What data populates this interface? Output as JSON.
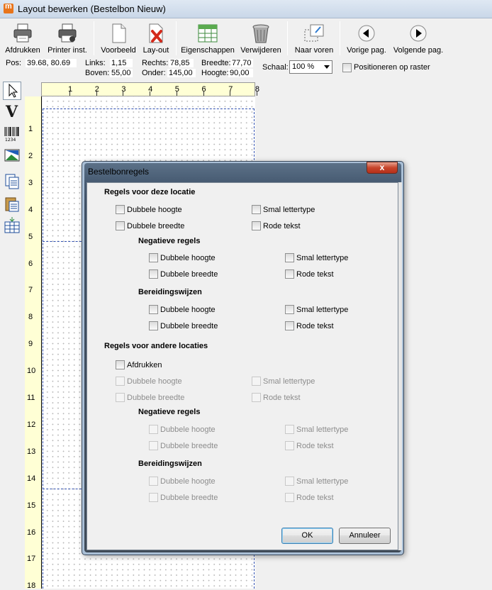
{
  "window": {
    "title": "Layout bewerken (Bestelbon Nieuw)"
  },
  "toolbar": {
    "buttons": [
      {
        "label": "Afdrukken",
        "icon": "printer-icon"
      },
      {
        "label": "Printer inst.",
        "icon": "printer-settings-icon"
      },
      {
        "label": "Voorbeeld",
        "icon": "document-icon"
      },
      {
        "label": "Lay-out",
        "icon": "layout-delete-icon"
      },
      {
        "label": "Eigenschappen",
        "icon": "table-properties-icon"
      },
      {
        "label": "Verwijderen",
        "icon": "trash-icon"
      },
      {
        "label": "Naar voren",
        "icon": "bring-forward-icon"
      },
      {
        "label": "Vorige pag.",
        "icon": "previous-arrow-icon"
      },
      {
        "label": "Volgende pag.",
        "icon": "next-arrow-icon"
      }
    ]
  },
  "info": {
    "pos_label": "Pos:",
    "pos_value": "39.68, 80.69",
    "links_label": "Links:",
    "links_value": "1,15",
    "boven_label": "Boven:",
    "boven_value": "55,00",
    "rechts_label": "Rechts:",
    "rechts_value": "78,85",
    "onder_label": "Onder:",
    "onder_value": "145,00",
    "breedte_label": "Breedte:",
    "breedte_value": "77,70",
    "hoogte_label": "Hoogte:",
    "hoogte_value": "90,00",
    "schaal_label": "Schaal:",
    "schaal_value": "100 %",
    "raster_label": "Positioneren op raster"
  },
  "tools": [
    "pointer-icon",
    "text-tool-icon",
    "barcode-icon",
    "image-tool-icon",
    "copy-icon",
    "paste-icon",
    "insert-field-icon"
  ],
  "ruler": {
    "top": [
      "1",
      "2",
      "3",
      "4",
      "5",
      "6",
      "7",
      "8"
    ],
    "left": [
      "1",
      "2",
      "3",
      "4",
      "5",
      "6",
      "7",
      "8",
      "9",
      "10",
      "11",
      "12",
      "13",
      "14",
      "15",
      "16",
      "17",
      "18"
    ]
  },
  "dialog": {
    "title": "Bestelbonregels",
    "close": "x",
    "section_this": "Regels voor deze locatie",
    "section_other": "Regels voor andere locaties",
    "sub_negative": "Negatieve regels",
    "sub_preparation": "Bereidingswijzen",
    "opt_double_height": "Dubbele hoogte",
    "opt_double_width": "Dubbele breedte",
    "opt_narrow": "Smal lettertype",
    "opt_red": "Rode tekst",
    "opt_print": "Afdrukken",
    "ok": "OK",
    "cancel": "Annuleer"
  },
  "colors": {
    "ruler_bg": "#ffffd5",
    "dialog_frame": "#485c73",
    "close_button": "#c7452c"
  }
}
